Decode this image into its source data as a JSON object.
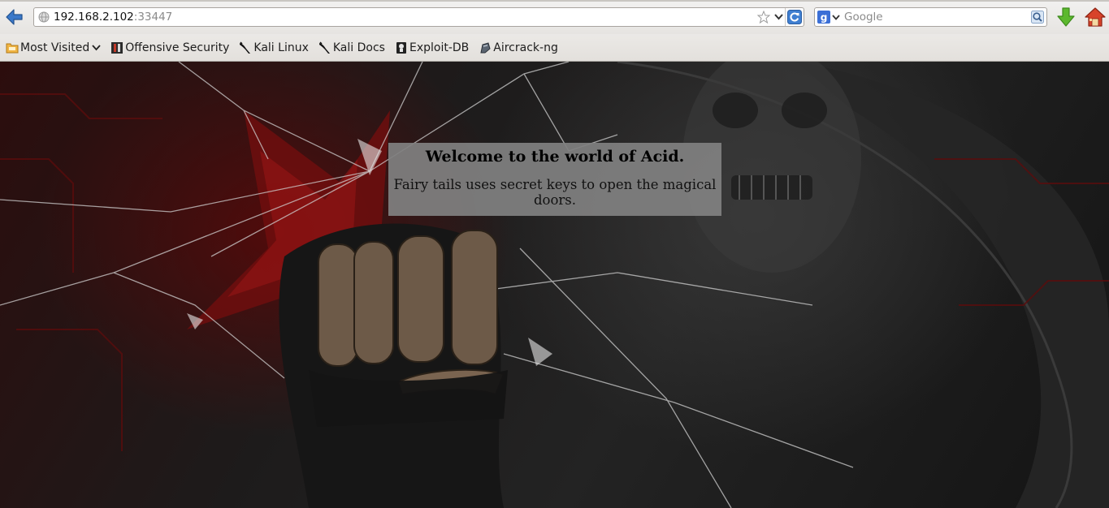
{
  "toolbar": {
    "url_host": "192.168.2.102",
    "url_port": ":33447",
    "search_placeholder": "Google"
  },
  "bookmarks": [
    {
      "label": "Most Visited",
      "icon": "folder-icon"
    },
    {
      "label": "Offensive Security",
      "icon": "offsec-icon"
    },
    {
      "label": "Kali Linux",
      "icon": "kali-dragon-icon"
    },
    {
      "label": "Kali Docs",
      "icon": "kali-dragon-icon"
    },
    {
      "label": "Exploit-DB",
      "icon": "exploitdb-icon"
    },
    {
      "label": "Aircrack-ng",
      "icon": "aircrack-icon"
    }
  ],
  "page": {
    "title": "Welcome to the world of Acid.",
    "message": "Fairy tails uses secret keys to open the magical doors."
  },
  "colors": {
    "accent_back": "#3a78c9",
    "download_green": "#5cb82e",
    "page_box": "#808080"
  }
}
